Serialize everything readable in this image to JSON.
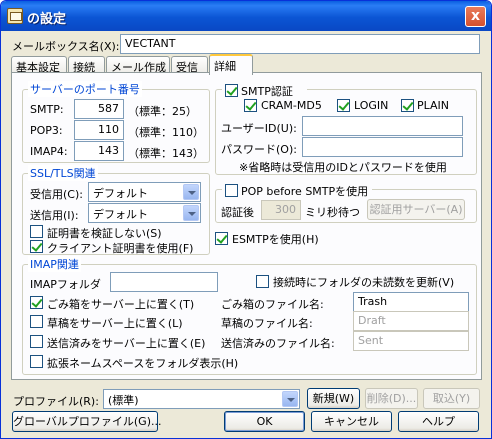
{
  "window": {
    "title": "の設定",
    "close_glyph": "x"
  },
  "mailbox": {
    "label": "メールボックス名(X):",
    "value": "VECTANT"
  },
  "tabs": [
    {
      "label": "基本設定"
    },
    {
      "label": "接続"
    },
    {
      "label": "メール作成"
    },
    {
      "label": "受信"
    },
    {
      "label": "詳細"
    }
  ],
  "ports": {
    "title": "サーバーのポート番号",
    "smtp": {
      "label": "SMTP:",
      "value": "587",
      "std": "（標準：25）"
    },
    "pop3": {
      "label": "POP3:",
      "value": "110",
      "std": "（標準：110）"
    },
    "imap4": {
      "label": "IMAP4:",
      "value": "143",
      "std": "（標準：143）"
    }
  },
  "smtp_auth": {
    "label": "SMTP認証",
    "checked": true,
    "cram": "CRAM-MD5",
    "login": "LOGIN",
    "plain": "PLAIN",
    "user_label": "ユーザーID(U):",
    "user_value": "",
    "pass_label": "パスワード(O):",
    "pass_value": "",
    "note": "※省略時は受信用のIDとパスワードを使用"
  },
  "ssl": {
    "title": "SSL/TLS関連",
    "recv_label": "受信用(C):",
    "recv_value": "デフォルト",
    "send_label": "送信用(I):",
    "send_value": "デフォルト",
    "no_verify": "証明書を検証しない(S)",
    "client_cert": "クライアント証明書を使用(F)"
  },
  "pop_before": {
    "label": "POP before SMTPを使用",
    "after_label": "認証後",
    "ms_value": "300",
    "ms_label": "ミリ秒待つ",
    "server_button": "認証用サーバー(A)"
  },
  "esmtp": {
    "label": "ESMTPを使用(H)"
  },
  "imap": {
    "title": "IMAP関連",
    "folder_label": "IMAPフォルダ",
    "folder_value": "",
    "update_unread": "接続時にフォルダの未読数を更新(V)",
    "trash_on_server": "ごみ箱をサーバー上に置く(T)",
    "trash_name_label": "ごみ箱のファイル名:",
    "trash_name_value": "Trash",
    "draft_on_server": "草稿をサーバー上に置く(L)",
    "draft_name_label": "草稿のファイル名:",
    "draft_name_value": "Draft",
    "sent_on_server": "送信済みをサーバー上に置く(E)",
    "sent_name_label": "送信済みのファイル名:",
    "sent_name_value": "Sent",
    "ns_display": "拡張ネームスペースをフォルダ表示(H)"
  },
  "profile": {
    "label": "プロファイル(R):",
    "value": "(標準)",
    "new_button": "新規(W)",
    "delete_button": "削除(D)...",
    "import_button": "取込(Y)"
  },
  "buttons": {
    "global_profile": "グローバルプロファイル(G)...",
    "ok": "OK",
    "cancel": "キャンセル",
    "help": "ヘルプ"
  },
  "colors": {
    "group_title": "#0046d5",
    "title_bar": "#0a5fe0",
    "check_mark": "#21a121"
  }
}
